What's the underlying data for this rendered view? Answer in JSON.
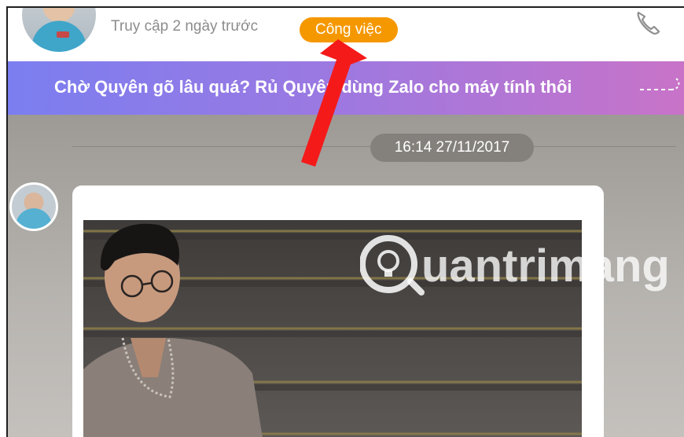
{
  "header": {
    "last_access": "Truy cập 2 ngày trước",
    "tag": "Công việc"
  },
  "banner": {
    "text": "Chờ Quyên gõ lâu quá? Rủ Quyên dùng Zalo cho máy tính thôi"
  },
  "chat": {
    "timestamp": "16:14 27/11/2017"
  },
  "watermark": {
    "text": "uantrimang"
  },
  "colors": {
    "tag_bg": "#f59800",
    "banner_start": "#7b7ef0",
    "banner_end": "#c873c8",
    "arrow": "#f41a1a"
  },
  "icons": {
    "call": "phone-icon",
    "annotation": "red-arrow-icon",
    "watermark_logo": "lightbulb-icon"
  }
}
